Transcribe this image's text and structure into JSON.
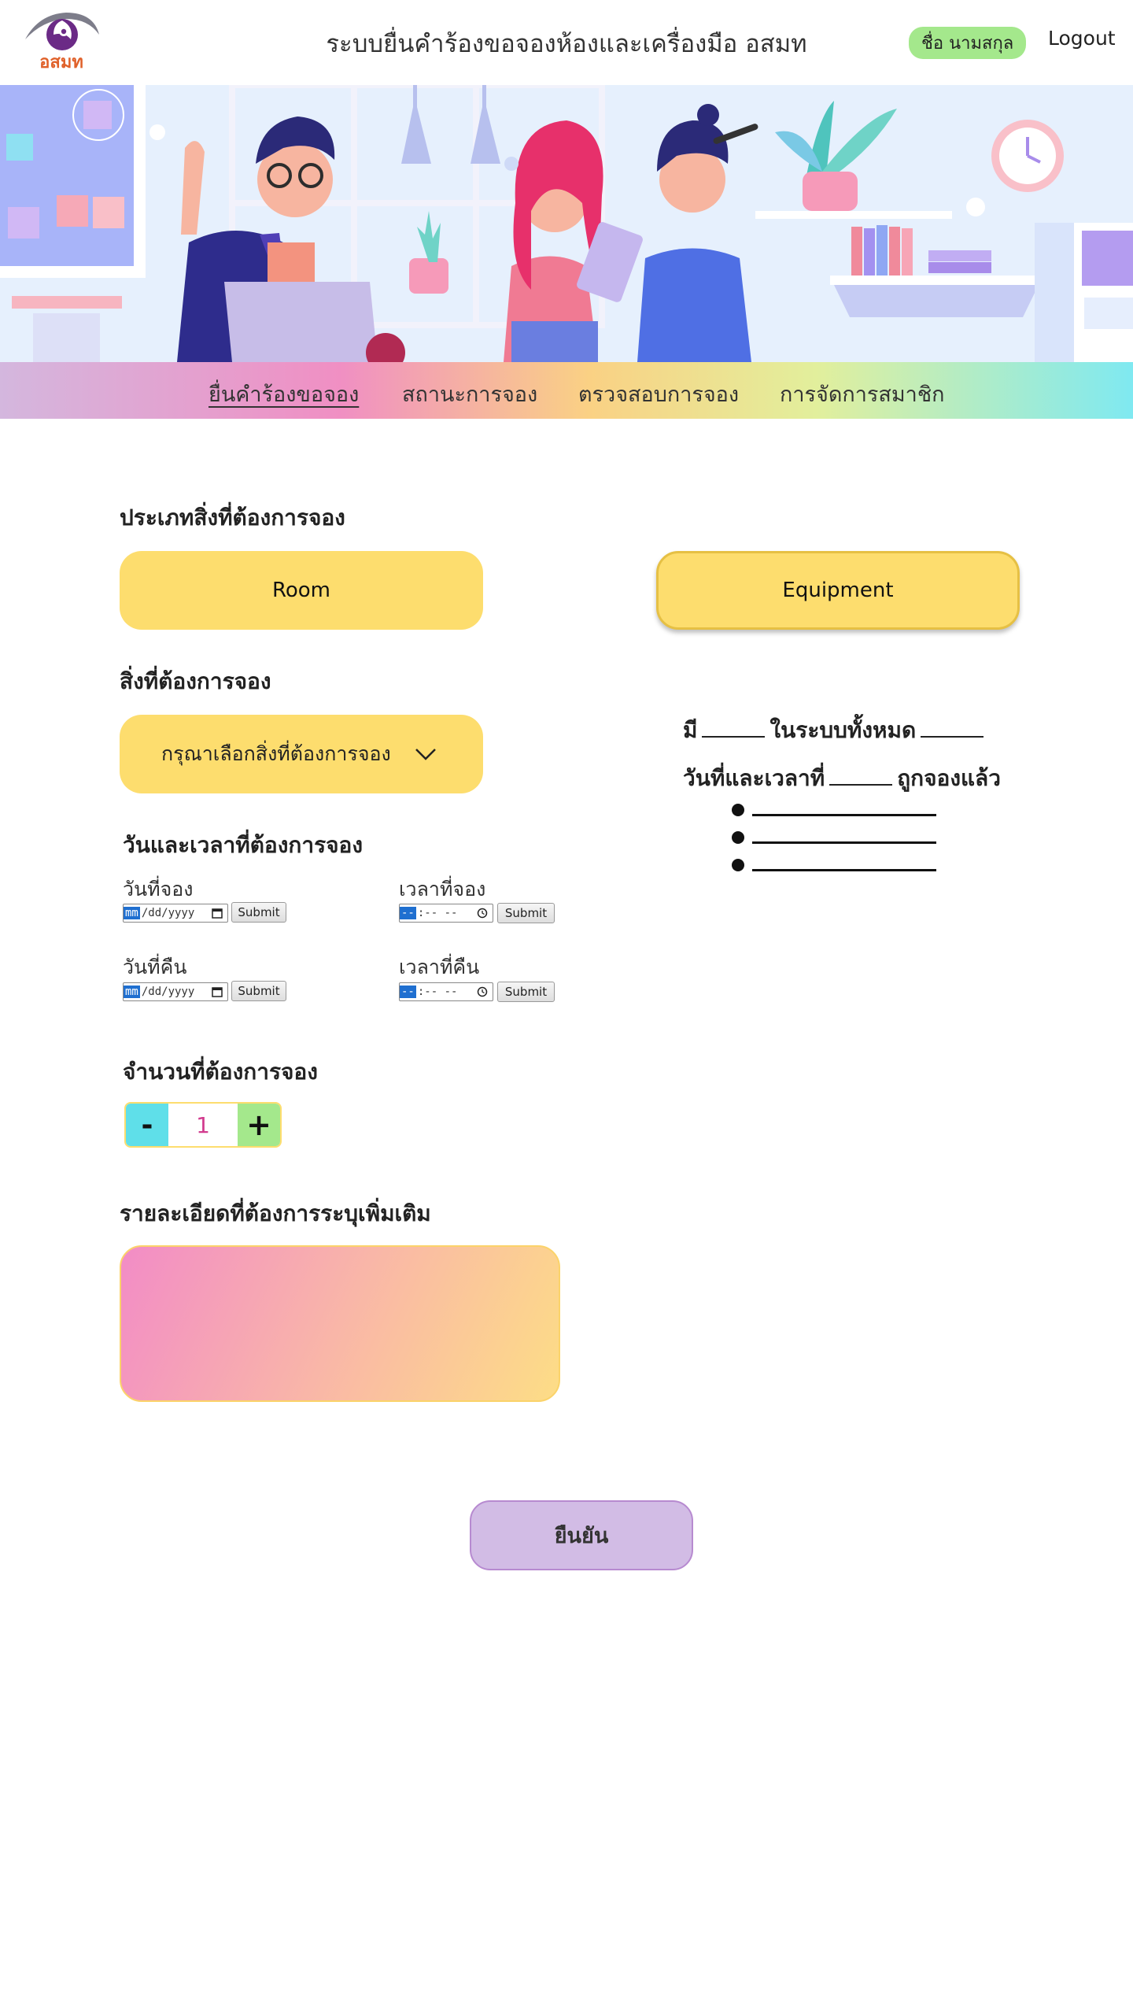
{
  "header": {
    "logo_text": "อสมท",
    "title": "ระบบยื่นคำร้องขอจองห้องและเครื่องมือ อสมท",
    "user_name": "ชื่อ นามสกุล",
    "logout_label": "Logout"
  },
  "nav": {
    "items": [
      {
        "label": "ยื่นคำร้องขอจอง",
        "active": true
      },
      {
        "label": "สถานะการจอง",
        "active": false
      },
      {
        "label": "ตรวจสอบการจอง",
        "active": false
      },
      {
        "label": "การจัดการสมาชิก",
        "active": false
      }
    ]
  },
  "form": {
    "type_label": "ประเภทสิ่งที่ต้องการจอง",
    "type_options": [
      "Room",
      "Equipment"
    ],
    "selected_type": "Equipment",
    "item_label": "สิ่งที่ต้องการจอง",
    "item_placeholder": "กรุณาเลือกสิ่งที่ต้องการจอง",
    "datetime_label": "วันและเวลาที่ต้องการจอง",
    "booking_date_label": "วันที่จอง",
    "booking_time_label": "เวลาที่จอง",
    "return_date_label": "วันที่คืน",
    "return_time_label": "เวลาที่คืน",
    "date_value_highlight": "mm",
    "date_value_rest": "/dd/yyyy",
    "time_value_highlight": "--",
    "time_value_rest": ":--  --",
    "submit_label": "Submit",
    "quantity_label": "จำนวนที่ต้องการจอง",
    "quantity_value": "1",
    "quantity_minus": "-",
    "quantity_plus": "+",
    "details_label": "รายละเอียดที่ต้องการระบุเพิ่มเติม",
    "details_value": "",
    "confirm_label": "ยืนยัน"
  },
  "info": {
    "line1_prefix": "มี",
    "line1_middle": "ในระบบทั้งหมด",
    "line2_prefix": "วันที่และเวลาที่",
    "line2_suffix": "ถูกจองแล้ว",
    "booked_slots": [
      "",
      "",
      ""
    ]
  },
  "colors": {
    "button_yellow": "#fddd6e",
    "user_badge_green": "#a4e88c",
    "minus_cyan": "#5fdfe9",
    "confirm_purple": "#d2bce5"
  }
}
